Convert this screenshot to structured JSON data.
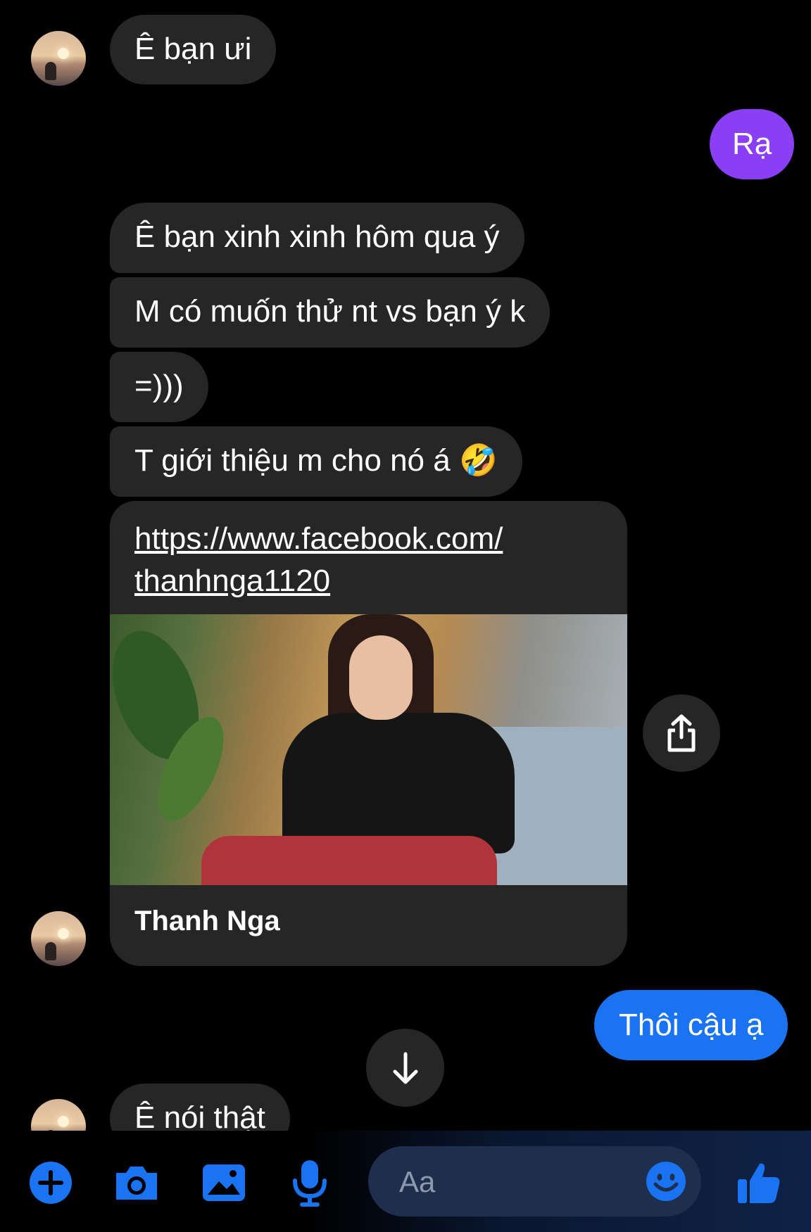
{
  "colors": {
    "background": "#000000",
    "received_bubble": "#262626",
    "sent_purple": "#8a3ff4",
    "sent_blue": "#1a73f0",
    "accent": "#1a73f0"
  },
  "messages": {
    "m1": "Ê bạn ưi",
    "m2": "Rạ",
    "m3": "Ê bạn xinh xinh hôm qua ý",
    "m4": "M có muốn thử nt vs bạn ý k",
    "m5": "=)))",
    "m6": "T giới thiệu m cho nó á 🤣",
    "m7": "Thôi cậu ạ",
    "m8": "Ê nói thật"
  },
  "link_card": {
    "url_line1": "https://www.facebook.com/",
    "url_line2": "thanhnga1120",
    "name": "Thanh Nga"
  },
  "composer": {
    "placeholder": "Aa"
  },
  "icons": {
    "add": "plus-circle-icon",
    "camera": "camera-icon",
    "gallery": "image-icon",
    "mic": "microphone-icon",
    "emoji": "smiley-icon",
    "like": "thumbs-up-icon",
    "share": "share-icon",
    "scroll": "arrow-down-icon"
  }
}
